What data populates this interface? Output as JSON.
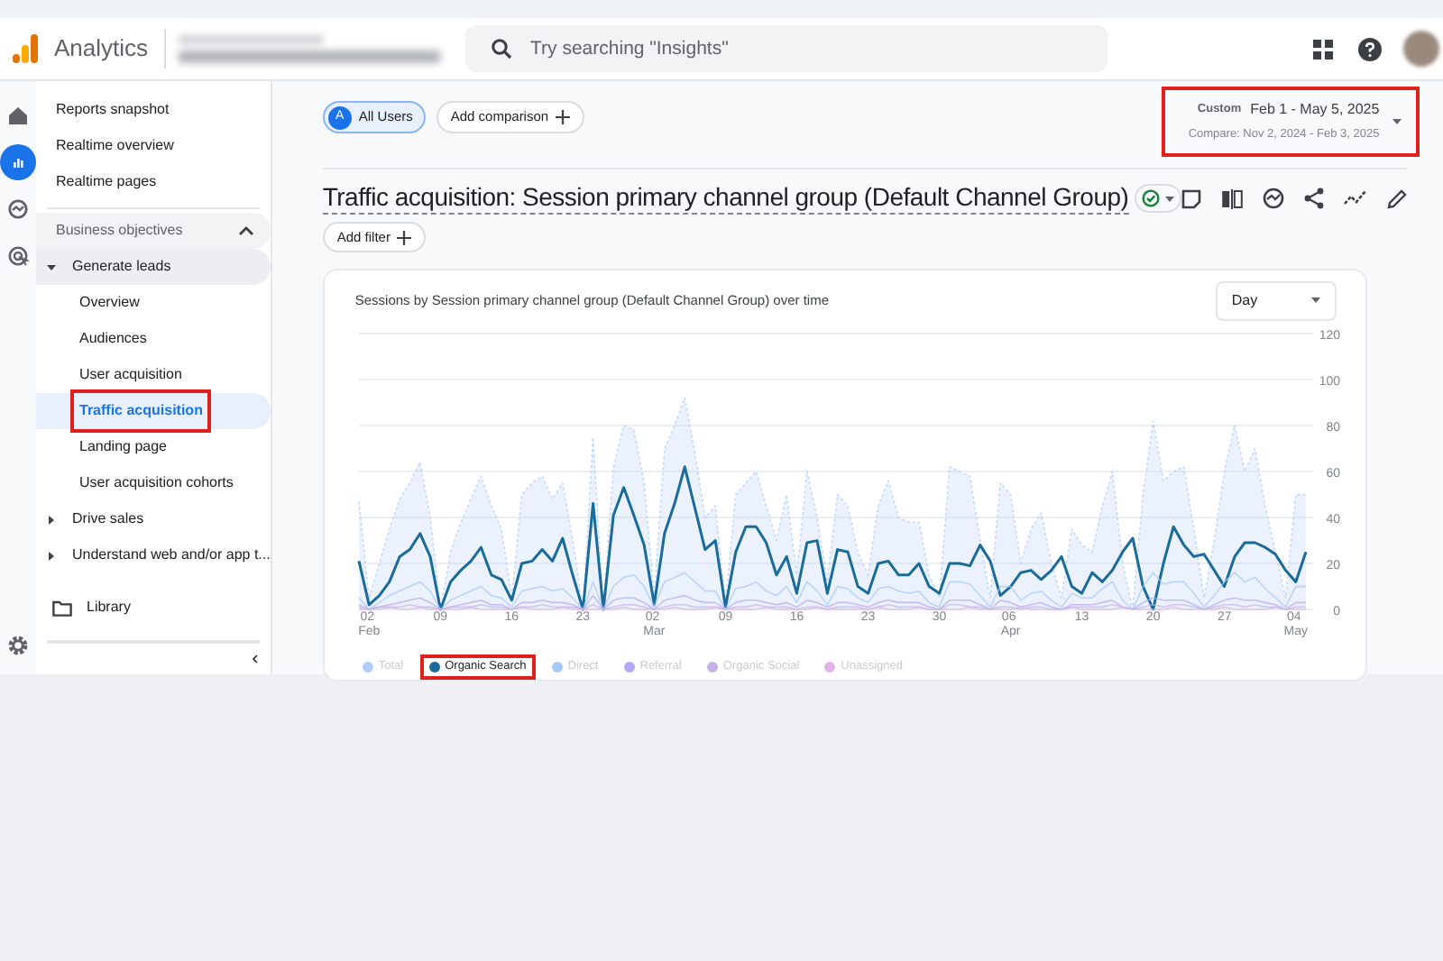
{
  "app": {
    "product": "Analytics"
  },
  "search": {
    "placeholder": "Try searching \"Insights\""
  },
  "rail": [
    {
      "kind": "home",
      "selected": false
    },
    {
      "kind": "reports",
      "selected": true
    },
    {
      "kind": "explore",
      "selected": false
    },
    {
      "kind": "advertising",
      "selected": false
    }
  ],
  "nav": {
    "top_items": [
      {
        "label": "Reports snapshot",
        "selected": false
      },
      {
        "label": "Realtime overview",
        "selected": false
      },
      {
        "label": "Realtime pages",
        "selected": false
      }
    ],
    "sections": [
      {
        "label": "Business objectives",
        "expanded": true,
        "children": [
          {
            "label": "Generate leads",
            "expanded": true,
            "children": [
              {
                "label": "Overview",
                "selected": false,
                "highlighted": false
              },
              {
                "label": "Audiences",
                "selected": false,
                "highlighted": false
              },
              {
                "label": "User acquisition",
                "selected": false,
                "highlighted": false
              },
              {
                "label": "Traffic acquisition",
                "selected": true,
                "highlighted": true
              },
              {
                "label": "Landing page",
                "selected": false,
                "highlighted": false
              },
              {
                "label": "User acquisition cohorts",
                "selected": false,
                "highlighted": false
              }
            ]
          },
          {
            "label": "Drive sales",
            "expanded": false
          },
          {
            "label": "Understand web and/or app t...",
            "expanded": false
          }
        ]
      }
    ],
    "library": {
      "label": "Library"
    }
  },
  "segments": [
    {
      "badge": "A",
      "label": "All Users"
    }
  ],
  "add_comparison": "Add comparison",
  "date_range": {
    "kind_label": "Custom",
    "range": "Feb 1 - May 5, 2025",
    "compare": "Compare: Nov 2, 2024 - Feb 3, 2025",
    "highlighted": true
  },
  "report": {
    "title": "Traffic acquisition: Session primary channel group (Default Channel Group)",
    "add_filter": "Add filter"
  },
  "card": {
    "title": "Sessions by Session primary channel group (Default Channel Group) over time",
    "granularity": "Day",
    "legend": [
      {
        "selected": false,
        "highlighted": false
      },
      {
        "selected": true,
        "highlighted": true
      },
      {
        "selected": false,
        "highlighted": false
      },
      {
        "selected": false,
        "highlighted": false
      },
      {
        "selected": false,
        "highlighted": false
      },
      {
        "selected": false,
        "highlighted": false
      }
    ],
    "chart_data": {
      "type": "line",
      "categories": [
        null,
        "02 Feb",
        null,
        null,
        null,
        null,
        null,
        null,
        "09",
        null,
        null,
        null,
        null,
        null,
        null,
        "16",
        null,
        null,
        null,
        null,
        null,
        null,
        "23",
        null,
        null,
        null,
        null,
        null,
        null,
        "02 Mar",
        null,
        null,
        null,
        null,
        null,
        null,
        "09",
        null,
        null,
        null,
        null,
        null,
        null,
        "16",
        null,
        null,
        null,
        null,
        null,
        null,
        "23",
        null,
        null,
        null,
        null,
        null,
        null,
        "30",
        null,
        null,
        null,
        null,
        null,
        null,
        "06 Apr",
        null,
        null,
        null,
        null,
        null,
        null,
        "13",
        null,
        null,
        null,
        null,
        null,
        null,
        "20",
        null,
        null,
        null,
        null,
        null,
        null,
        "27",
        null,
        null,
        null,
        null,
        null,
        null,
        "04 May",
        null
      ],
      "series": [
        {
          "name": "Total",
          "color": "#aecbfa",
          "type": "area",
          "line_style": "dotted",
          "values": [
            47,
            5,
            20,
            35,
            48,
            55,
            64,
            40,
            0,
            25,
            38,
            48,
            58,
            45,
            35,
            5,
            50,
            55,
            58,
            48,
            55,
            30,
            0,
            75,
            0,
            62,
            80,
            78,
            55,
            5,
            70,
            80,
            92,
            68,
            40,
            45,
            2,
            50,
            55,
            60,
            45,
            30,
            50,
            15,
            60,
            40,
            12,
            50,
            45,
            25,
            15,
            45,
            56,
            40,
            38,
            38,
            15,
            5,
            62,
            60,
            58,
            30,
            5,
            55,
            50,
            20,
            35,
            42,
            20,
            5,
            35,
            28,
            25,
            45,
            60,
            20,
            0,
            50,
            82,
            56,
            60,
            62,
            35,
            5,
            30,
            60,
            80,
            60,
            70,
            45,
            25,
            5,
            50,
            50
          ]
        },
        {
          "name": "Organic Search",
          "color": "#1a6b9a",
          "values": [
            21,
            2,
            6,
            12,
            23,
            26,
            33,
            23,
            0,
            12,
            17,
            21,
            27,
            15,
            13,
            4,
            20,
            21,
            26,
            21,
            31,
            15,
            0,
            46,
            0,
            41,
            53,
            41,
            28,
            2,
            33,
            46,
            62,
            44,
            26,
            30,
            1,
            25,
            36,
            36,
            29,
            15,
            23,
            7,
            29,
            30,
            7,
            26,
            25,
            10,
            7,
            20,
            21,
            15,
            15,
            20,
            10,
            7,
            20,
            20,
            19,
            28,
            21,
            6,
            10,
            16,
            17,
            13,
            17,
            23,
            10,
            7,
            16,
            12,
            17,
            25,
            31,
            10,
            0,
            20,
            36,
            28,
            23,
            24,
            17,
            10,
            23,
            29,
            29,
            27,
            24,
            17,
            12,
            25
          ]
        },
        {
          "name": "Direct",
          "color": "#a8c7fa",
          "values": [
            5,
            0,
            3,
            6,
            8,
            10,
            12,
            8,
            0,
            4,
            6,
            8,
            10,
            6,
            5,
            1,
            8,
            9,
            10,
            8,
            9,
            5,
            0,
            12,
            0,
            10,
            14,
            15,
            10,
            1,
            12,
            14,
            16,
            12,
            8,
            8,
            0,
            9,
            10,
            12,
            8,
            6,
            10,
            3,
            12,
            8,
            2,
            10,
            9,
            5,
            3,
            9,
            10,
            8,
            7,
            8,
            3,
            1,
            12,
            12,
            11,
            6,
            1,
            10,
            10,
            4,
            7,
            8,
            4,
            1,
            7,
            5,
            5,
            9,
            12,
            4,
            0,
            10,
            16,
            11,
            12,
            12,
            7,
            1,
            6,
            12,
            16,
            12,
            14,
            9,
            5,
            1,
            10,
            10
          ]
        },
        {
          "name": "Referral",
          "color": "#b4a7f5",
          "values": [
            2,
            0,
            1,
            2,
            3,
            4,
            5,
            3,
            0,
            1,
            2,
            3,
            4,
            2,
            2,
            0,
            3,
            3,
            4,
            3,
            3,
            2,
            0,
            6,
            0,
            4,
            5,
            5,
            3,
            0,
            4,
            5,
            6,
            4,
            3,
            3,
            0,
            3,
            4,
            4,
            3,
            2,
            3,
            1,
            4,
            3,
            1,
            3,
            3,
            2,
            1,
            3,
            4,
            3,
            3,
            3,
            1,
            0,
            4,
            4,
            4,
            2,
            0,
            4,
            3,
            1,
            2,
            3,
            1,
            0,
            2,
            2,
            2,
            3,
            4,
            1,
            0,
            3,
            5,
            4,
            4,
            4,
            2,
            0,
            2,
            4,
            5,
            4,
            4,
            3,
            2,
            0,
            3,
            3
          ]
        },
        {
          "name": "Organic Social",
          "color": "#c5b3e6",
          "values": [
            1,
            0,
            1,
            1,
            1,
            2,
            1,
            1,
            0,
            1,
            1,
            1,
            2,
            1,
            1,
            0,
            1,
            1,
            2,
            1,
            1,
            1,
            0,
            2,
            0,
            1,
            2,
            2,
            1,
            0,
            1,
            2,
            2,
            1,
            1,
            1,
            0,
            1,
            1,
            2,
            1,
            1,
            1,
            0,
            1,
            1,
            0,
            1,
            1,
            1,
            0,
            1,
            2,
            1,
            1,
            1,
            0,
            0,
            2,
            2,
            1,
            1,
            0,
            1,
            1,
            0,
            1,
            1,
            0,
            0,
            1,
            1,
            1,
            1,
            2,
            1,
            0,
            1,
            2,
            1,
            2,
            2,
            1,
            0,
            1,
            2,
            2,
            1,
            2,
            1,
            1,
            0,
            1,
            1
          ]
        },
        {
          "name": "Unassigned",
          "color": "#e1b3e8",
          "values": [
            0,
            0,
            0,
            1,
            0,
            0,
            1,
            0,
            0,
            0,
            0,
            1,
            0,
            0,
            0,
            0,
            1,
            0,
            0,
            0,
            1,
            0,
            0,
            0,
            0,
            0,
            1,
            0,
            0,
            0,
            0,
            1,
            0,
            0,
            0,
            1,
            0,
            0,
            0,
            0,
            1,
            0,
            0,
            0,
            0,
            1,
            0,
            0,
            0,
            0,
            0,
            1,
            0,
            0,
            0,
            1,
            0,
            0,
            0,
            0,
            1,
            0,
            0,
            0,
            0,
            1,
            0,
            0,
            0,
            0,
            1,
            0,
            0,
            0,
            0,
            1,
            0,
            0,
            0,
            0,
            1,
            0,
            0,
            0,
            0,
            1,
            0,
            0,
            0,
            0,
            1,
            0,
            0,
            0
          ]
        }
      ],
      "yticks": [
        0,
        20,
        40,
        60,
        80,
        100,
        120
      ],
      "grid": true,
      "ylim": [
        0,
        120
      ]
    }
  }
}
